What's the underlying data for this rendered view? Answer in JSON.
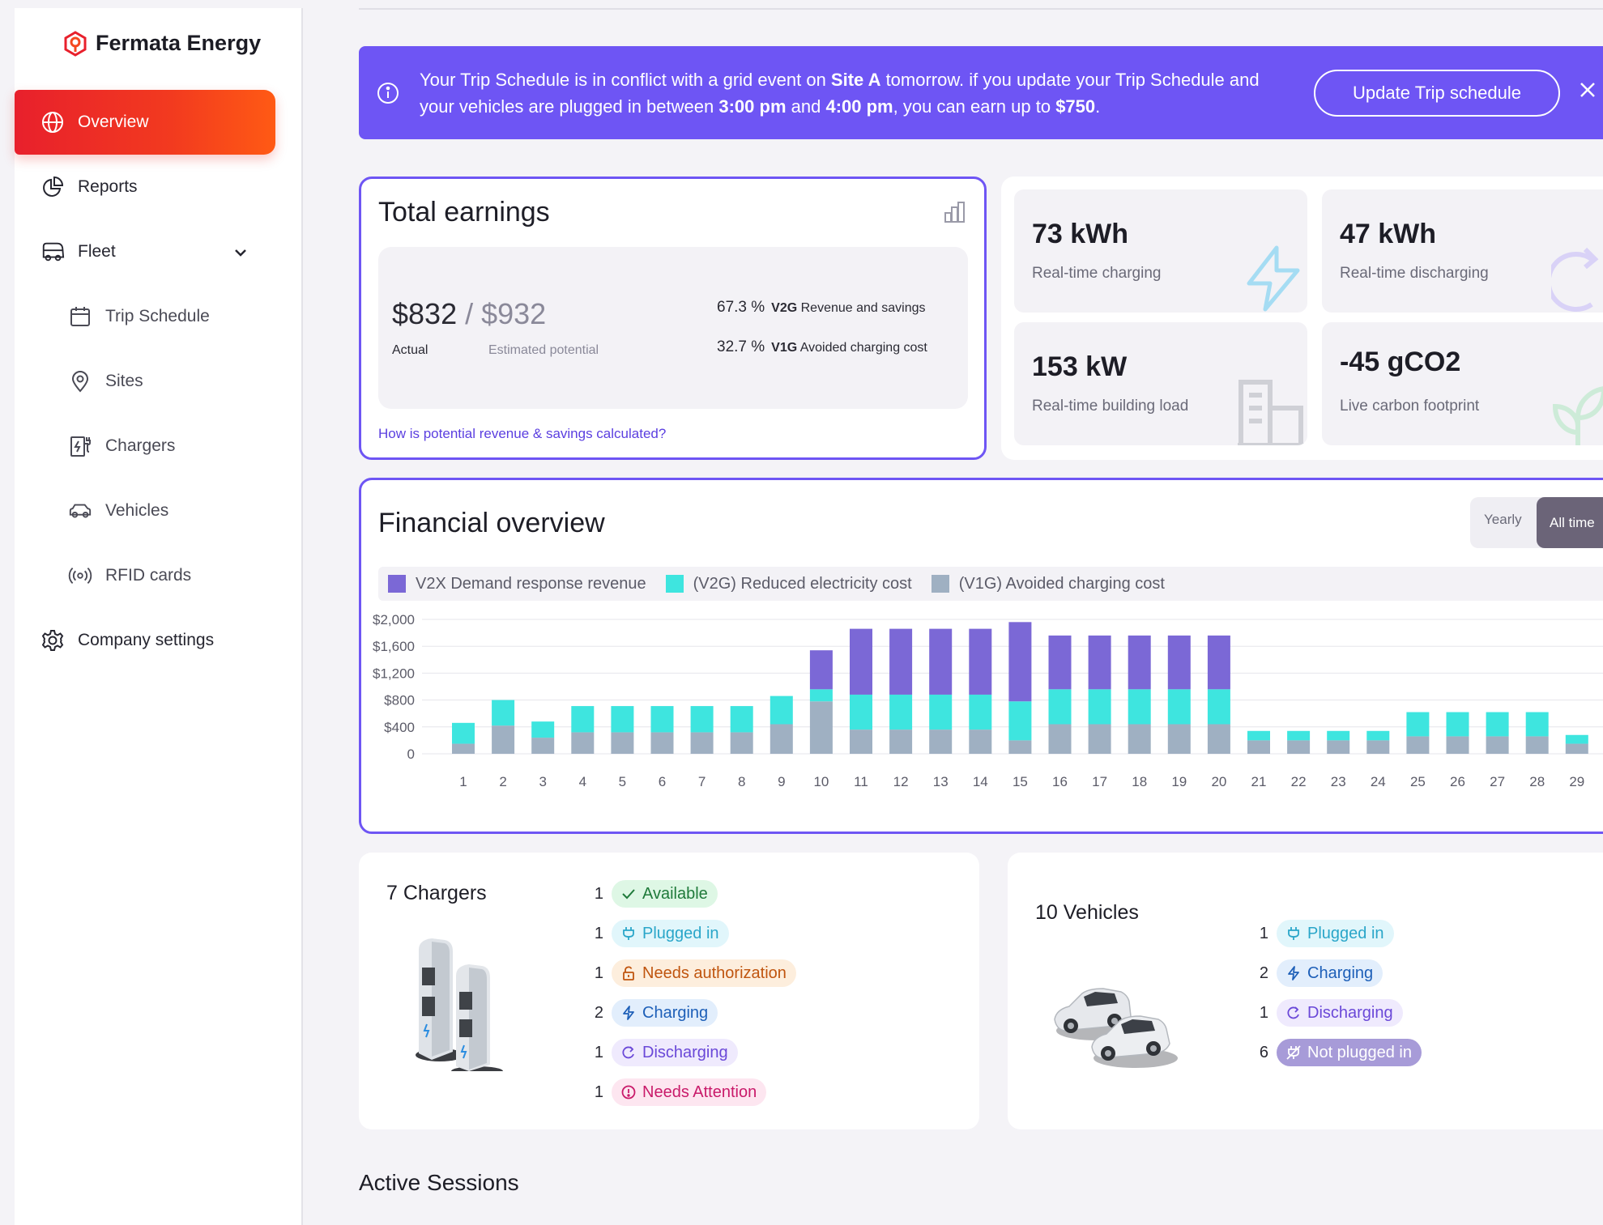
{
  "brand": {
    "name": "Fermata Energy",
    "accent": "#e8202c"
  },
  "nav": {
    "overview": "Overview",
    "reports": "Reports",
    "fleet": "Fleet",
    "trip_schedule": "Trip Schedule",
    "sites": "Sites",
    "chargers": "Chargers",
    "vehicles": "Vehicles",
    "rfid": "RFID cards",
    "company_settings": "Company settings"
  },
  "banner": {
    "t1": "Your Trip Schedule is in conflict with a grid event on ",
    "site": "Site A",
    "t2": " tomorrow. if you update your Trip Schedule and your vehicles are plugged in between ",
    "start": "3:00 pm",
    "t3": " and ",
    "end": "4:00 pm",
    "t4": ", you can earn up to ",
    "amount": "$750",
    "t5": ".",
    "button": "Update Trip schedule",
    "color": "#6e55f4"
  },
  "earnings": {
    "title": "Total earnings",
    "actual": "$832",
    "separator": " / ",
    "potential": "$932",
    "actual_label": "Actual",
    "potential_label": "Estimated potential",
    "rows": [
      {
        "pct": "67.3 %",
        "tag": "V2G",
        "text": " Revenue and savings"
      },
      {
        "pct": "32.7 %",
        "tag": "V1G",
        "text": " Avoided charging cost"
      }
    ],
    "link": "How is potential revenue & savings calculated?"
  },
  "metrics": [
    {
      "value": "73 kWh",
      "caption": "Real-time charging",
      "icon": "lightning-icon"
    },
    {
      "value": "47 kWh",
      "caption": "Real-time discharging",
      "icon": "refresh-icon"
    },
    {
      "value": "153 kW",
      "caption": "Real-time building load",
      "icon": "building-icon"
    },
    {
      "value": "-45 gCO2",
      "caption": "Live carbon footprint",
      "icon": "leaf-icon"
    }
  ],
  "financial": {
    "title": "Financial overview",
    "toggle": {
      "yearly": "Yearly",
      "all_time": "All time",
      "selected": "All time"
    },
    "legend": [
      {
        "label": "V2X Demand response revenue",
        "color": "#7b68d6"
      },
      {
        "label": "(V2G) Reduced electricity cost",
        "color": "#3ee5df"
      },
      {
        "label": "(V1G) Avoided charging cost",
        "color": "#9fb0c2"
      }
    ]
  },
  "chart_data": {
    "type": "bar",
    "stacked": true,
    "categories": [
      "1",
      "2",
      "3",
      "4",
      "5",
      "6",
      "7",
      "8",
      "9",
      "10",
      "11",
      "12",
      "13",
      "14",
      "15",
      "16",
      "17",
      "18",
      "19",
      "20",
      "21",
      "22",
      "23",
      "24",
      "25",
      "26",
      "27",
      "28",
      "29"
    ],
    "series": [
      {
        "name": "(V1G) Avoided charging cost",
        "values": [
          150,
          420,
          240,
          320,
          320,
          320,
          320,
          320,
          440,
          780,
          360,
          360,
          360,
          360,
          200,
          440,
          440,
          440,
          440,
          440,
          200,
          200,
          200,
          200,
          260,
          260,
          260,
          260,
          150
        ]
      },
      {
        "name": "(V2G) Reduced electricity cost",
        "values": [
          310,
          380,
          240,
          390,
          390,
          390,
          390,
          390,
          420,
          180,
          520,
          520,
          520,
          520,
          580,
          520,
          520,
          520,
          520,
          520,
          140,
          140,
          140,
          140,
          360,
          360,
          360,
          360,
          130
        ]
      },
      {
        "name": "V2X Demand response revenue",
        "values": [
          0,
          0,
          0,
          0,
          0,
          0,
          0,
          0,
          0,
          580,
          980,
          980,
          980,
          980,
          1180,
          800,
          800,
          800,
          800,
          800,
          0,
          0,
          0,
          0,
          0,
          0,
          0,
          0,
          0
        ]
      }
    ],
    "yticks": [
      "$2,000",
      "$1,600",
      "$1,200",
      "$800",
      "$400",
      "0"
    ],
    "ylim": [
      0,
      2000
    ],
    "grid": true,
    "legend_position": "top"
  },
  "chargers": {
    "title": "7 Chargers",
    "statuses": [
      {
        "n": "1",
        "label": "Available",
        "icon": "check-icon",
        "bg": "#def7e5",
        "fg": "#1f7a3a"
      },
      {
        "n": "1",
        "label": "Plugged in",
        "icon": "plug-icon",
        "bg": "#e1f6fb",
        "fg": "#2aa6c9"
      },
      {
        "n": "1",
        "label": "Needs authorization",
        "icon": "lock-icon",
        "bg": "#fdeedd",
        "fg": "#c0550f"
      },
      {
        "n": "2",
        "label": "Charging",
        "icon": "lightning-icon",
        "bg": "#e2eefc",
        "fg": "#1d5fb8"
      },
      {
        "n": "1",
        "label": "Discharging",
        "icon": "refresh-icon",
        "bg": "#efeafd",
        "fg": "#6a48d8"
      },
      {
        "n": "1",
        "label": "Needs Attention",
        "icon": "alert-icon",
        "bg": "#fde6f0",
        "fg": "#c91a6a"
      }
    ]
  },
  "vehicles": {
    "title": "10 Vehicles",
    "statuses": [
      {
        "n": "1",
        "label": "Plugged in",
        "icon": "plug-icon",
        "bg": "#e1f6fb",
        "fg": "#2aa6c9"
      },
      {
        "n": "2",
        "label": "Charging",
        "icon": "lightning-icon",
        "bg": "#e2eefc",
        "fg": "#1d5fb8"
      },
      {
        "n": "1",
        "label": "Discharging",
        "icon": "refresh-icon",
        "bg": "#efeafd",
        "fg": "#6a48d8"
      },
      {
        "n": "6",
        "label": "Not plugged in",
        "icon": "unplugged-icon",
        "bg": "#a79bd8",
        "fg": "#ffffff"
      }
    ]
  },
  "active_sessions": {
    "title": "Active Sessions"
  }
}
